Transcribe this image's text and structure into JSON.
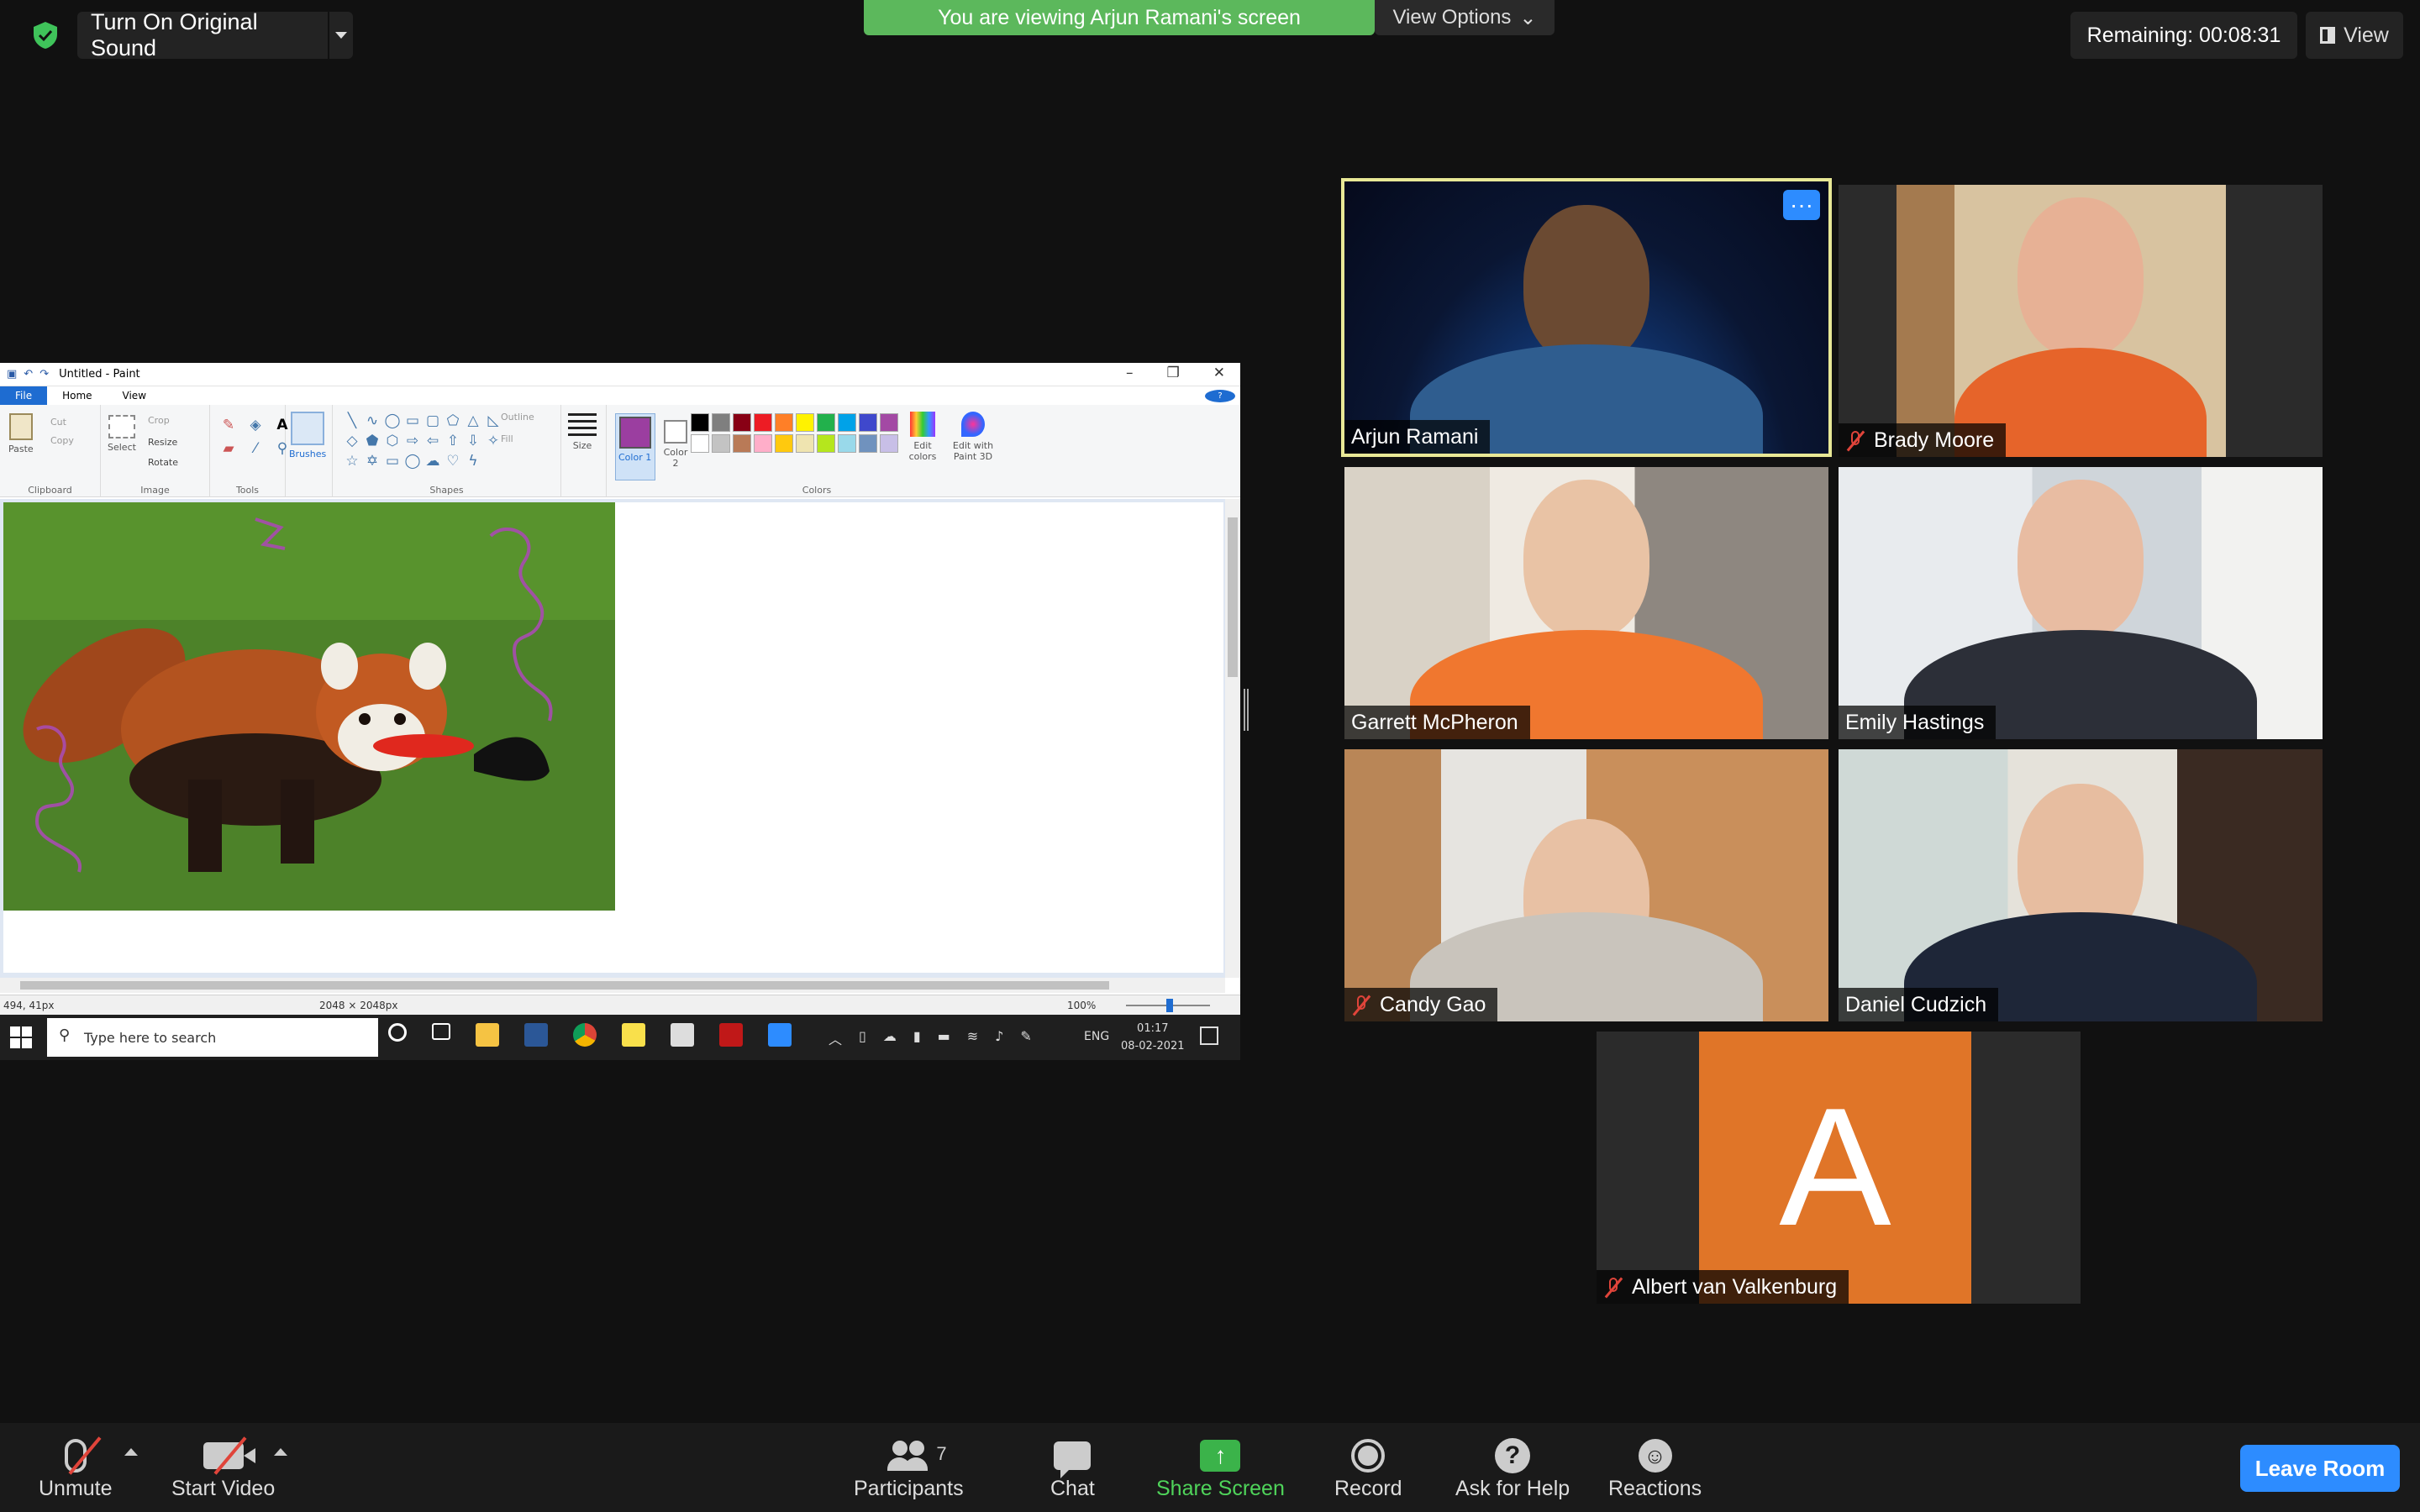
{
  "top_bar": {
    "original_sound_label": "Turn On Original Sound",
    "viewing_banner": "You are viewing Arjun Ramani's screen",
    "view_options_label": "View Options",
    "remaining_label": "Remaining: 00:08:31",
    "view_label": "View"
  },
  "shared_screen": {
    "title": "Untitled - Paint",
    "tabs": [
      "File",
      "Home",
      "View"
    ],
    "ribbon": {
      "paste": "Paste",
      "cut": "Cut",
      "copy": "Copy",
      "clipboard": "Clipboard",
      "select": "Select",
      "crop": "Crop",
      "resize": "Resize",
      "rotate": "Rotate",
      "image": "Image",
      "tools": "Tools",
      "brushes": "Brushes",
      "outline": "Outline",
      "fill": "Fill",
      "shapes": "Shapes",
      "size": "Size",
      "color1": "Color 1",
      "color2": "Color 2",
      "colors": "Colors",
      "edit_colors": "Edit colors",
      "edit_3d": "Edit with Paint 3D"
    },
    "palette": [
      "#000000",
      "#7f7f7f",
      "#880015",
      "#ed1c24",
      "#ff7f27",
      "#fff200",
      "#22b14c",
      "#00a2e8",
      "#3f48cc",
      "#a349a4",
      "#ffffff",
      "#c3c3c3",
      "#b97a57",
      "#ffaec9",
      "#ffc90e",
      "#efe4b0",
      "#b5e61d",
      "#99d9ea",
      "#7092be",
      "#c8bfe7"
    ],
    "status": {
      "cursor": "494, 41px",
      "size": "2048 × 2048px",
      "zoom": "100%"
    },
    "taskbar": {
      "search_placeholder": "Type here to search",
      "lang": "ENG",
      "time": "01:17",
      "date": "08-02-2021"
    }
  },
  "participants": [
    {
      "name": "Arjun Ramani",
      "muted": false,
      "active": true
    },
    {
      "name": "Brady Moore",
      "muted": true,
      "active": false
    },
    {
      "name": "Garrett McPheron",
      "muted": false,
      "active": false
    },
    {
      "name": "Emily Hastings",
      "muted": false,
      "active": false
    },
    {
      "name": "Candy Gao",
      "muted": true,
      "active": false
    },
    {
      "name": "Daniel Cudzich",
      "muted": false,
      "active": false
    },
    {
      "name": "Albert van Valkenburg",
      "muted": true,
      "active": false,
      "avatar_letter": "A"
    }
  ],
  "toolbar": {
    "unmute": "Unmute",
    "start_video": "Start Video",
    "participants": "Participants",
    "participant_count": "7",
    "chat": "Chat",
    "share_screen": "Share Screen",
    "record": "Record",
    "ask_for_help": "Ask for Help",
    "reactions": "Reactions",
    "leave_room": "Leave Room"
  },
  "colors": {
    "accent_blue": "#2d8cff",
    "share_green": "#4fd45a",
    "banner_green": "#5cb85c",
    "muted_red": "#e0443a",
    "avatar_orange": "#e07528"
  }
}
